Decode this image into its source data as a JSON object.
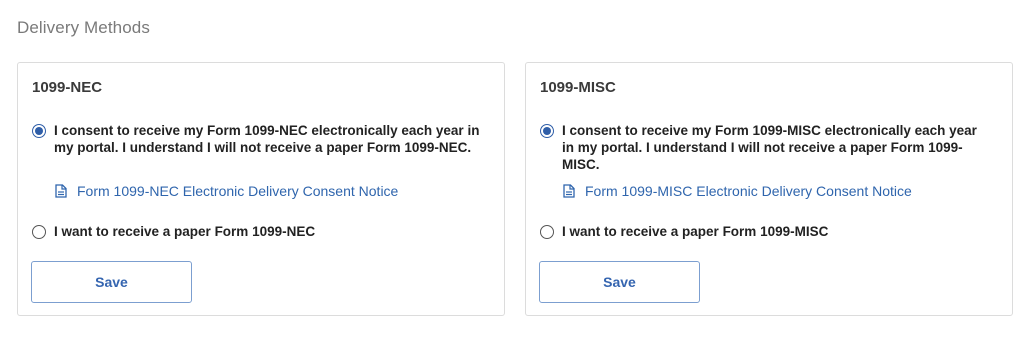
{
  "page": {
    "title": "Delivery Methods"
  },
  "cards": [
    {
      "title": "1099-NEC",
      "option_electronic": "I consent to receive my Form 1099-NEC electronically each year in my portal. I understand I will not receive a paper Form 1099-NEC.",
      "electronic_selected": true,
      "notice_link": "Form 1099-NEC Electronic Delivery Consent Notice",
      "option_paper": "I want to receive a paper Form 1099-NEC",
      "paper_selected": false,
      "save_label": "Save"
    },
    {
      "title": "1099-MISC",
      "option_electronic": "I consent to receive my Form 1099-MISC electronically each year in my portal. I understand I will not receive a paper Form 1099-MISC.",
      "electronic_selected": true,
      "notice_link": "Form 1099-MISC Electronic Delivery Consent Notice",
      "option_paper": "I want to receive a paper Form 1099-MISC",
      "paper_selected": false,
      "save_label": "Save"
    }
  ],
  "colors": {
    "accent": "#2f5ea8",
    "link": "#2f65ad",
    "border": "#dcdcdc"
  },
  "icons": {
    "notice": "document-icon"
  }
}
